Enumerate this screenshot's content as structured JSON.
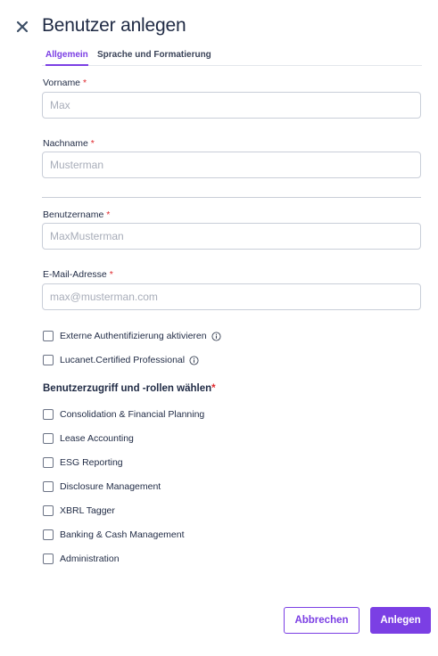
{
  "dialog": {
    "title": "Benutzer anlegen"
  },
  "tabs": [
    {
      "label": "Allgemein",
      "active": true
    },
    {
      "label": "Sprache und Formatierung",
      "active": false
    }
  ],
  "form": {
    "first_name": {
      "label": "Vorname",
      "required": "*",
      "placeholder": "Max",
      "value": ""
    },
    "last_name": {
      "label": "Nachname",
      "required": "*",
      "placeholder": "Musterman",
      "value": ""
    },
    "username": {
      "label": "Benutzername",
      "required": "*",
      "placeholder": "MaxMusterman",
      "value": ""
    },
    "email": {
      "label": "E-Mail-Adresse",
      "required": "*",
      "placeholder": "max@musterman.com",
      "value": ""
    }
  },
  "options": [
    {
      "label": "Externe Authentifizierung aktivieren",
      "checked": false,
      "icon": "info-icon"
    },
    {
      "label": "Lucanet.Certified Professional",
      "checked": false,
      "icon": "info-icon"
    }
  ],
  "roles": {
    "title": "Benutzerzugriff und -rollen wählen",
    "required": "*",
    "items": [
      {
        "label": "Consolidation & Financial Planning",
        "checked": false
      },
      {
        "label": "Lease Accounting",
        "checked": false
      },
      {
        "label": "ESG Reporting",
        "checked": false
      },
      {
        "label": "Disclosure Management",
        "checked": false
      },
      {
        "label": "XBRL Tagger",
        "checked": false
      },
      {
        "label": "Banking & Cash Management",
        "checked": false
      },
      {
        "label": "Administration",
        "checked": false
      }
    ]
  },
  "footer": {
    "cancel_label": "Abbrechen",
    "create_label": "Anlegen"
  },
  "colors": {
    "accent": "#7b3fe4",
    "required": "#e0292e",
    "text": "#1f2a44",
    "border": "#c9ced8"
  }
}
